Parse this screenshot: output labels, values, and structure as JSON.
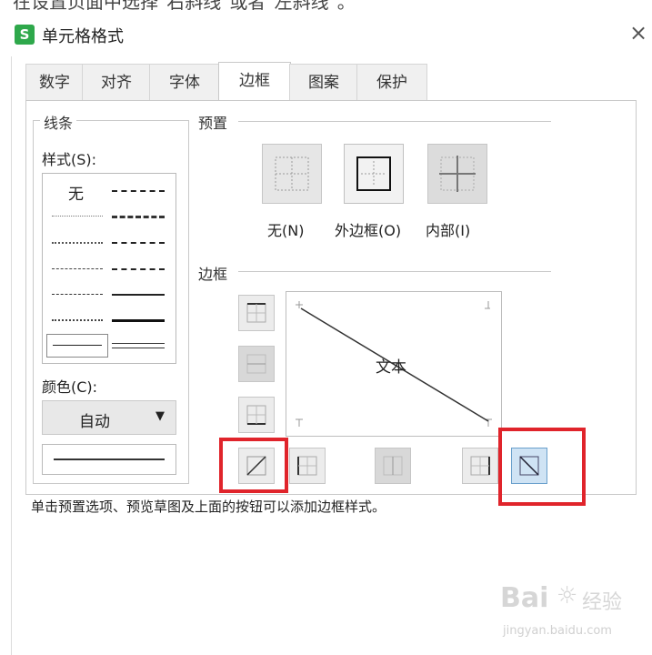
{
  "top_caption": "在设置页面中选择\"右斜线\"或者\"左斜线\"。",
  "dialog": {
    "app_icon": "S",
    "title": "单元格格式",
    "close": "×"
  },
  "tabs": [
    "数字",
    "对齐",
    "字体",
    "边框",
    "图案",
    "保护"
  ],
  "active_tab": "边框",
  "line_group": {
    "legend": "线条",
    "style_label": "样式(S):",
    "none_option": "无",
    "color_label": "颜色(C):",
    "color_value": "自动",
    "dropdown_arrow": "▼"
  },
  "preset_group": {
    "legend": "预置",
    "items": [
      {
        "label": "无(N)",
        "icon": "preset-none-icon"
      },
      {
        "label": "外边框(O)",
        "icon": "preset-outline-icon"
      },
      {
        "label": "内部(I)",
        "icon": "preset-inside-icon"
      }
    ]
  },
  "border_group": {
    "legend": "边框",
    "preview_text": "文本",
    "buttons": [
      "border-top-icon",
      "border-middle-h-icon",
      "border-bottom-icon",
      "diagonal-up-icon",
      "border-left-icon",
      "border-middle-v-icon",
      "border-right-icon",
      "diagonal-down-icon"
    ]
  },
  "hint": "单击预置选项、预览草图及上面的按钮可以添加边框样式。",
  "watermark": {
    "brand": "Bai",
    "brand2": "经验",
    "url": "jingyan.baidu.com"
  },
  "colors": {
    "highlight": "#e0242b",
    "selected_button": "#cfe3f4",
    "app_icon": "#2ea84b"
  }
}
